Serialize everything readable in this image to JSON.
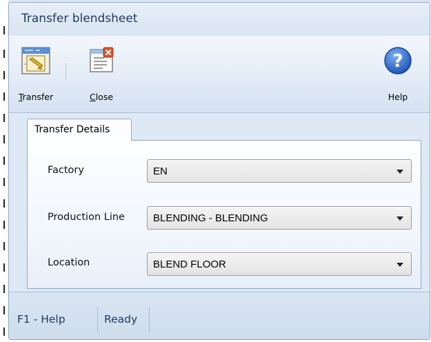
{
  "window": {
    "title": "Transfer blendsheet"
  },
  "toolbar": {
    "transfer": {
      "mnemonic": "T",
      "rest": "ransfer",
      "icon": "transfer-icon"
    },
    "close": {
      "mnemonic": "C",
      "rest": "lose",
      "icon": "close-document-icon"
    },
    "help": {
      "label": "Help",
      "icon": "help-icon"
    }
  },
  "tabs": [
    {
      "label": "Transfer Details"
    }
  ],
  "form": {
    "factory": {
      "label": "Factory",
      "value": "EN"
    },
    "production_line": {
      "label": "Production Line",
      "value": "BLENDING - BLENDING"
    },
    "location": {
      "label": "Location",
      "value": "BLEND FLOOR"
    }
  },
  "statusbar": {
    "help": "F1 - Help",
    "state": "Ready"
  },
  "colors": {
    "title_text": "#1e395b",
    "window_bg": "#dfe9f5",
    "border": "#8ea9c8",
    "help_blue": "#2a63c4"
  }
}
